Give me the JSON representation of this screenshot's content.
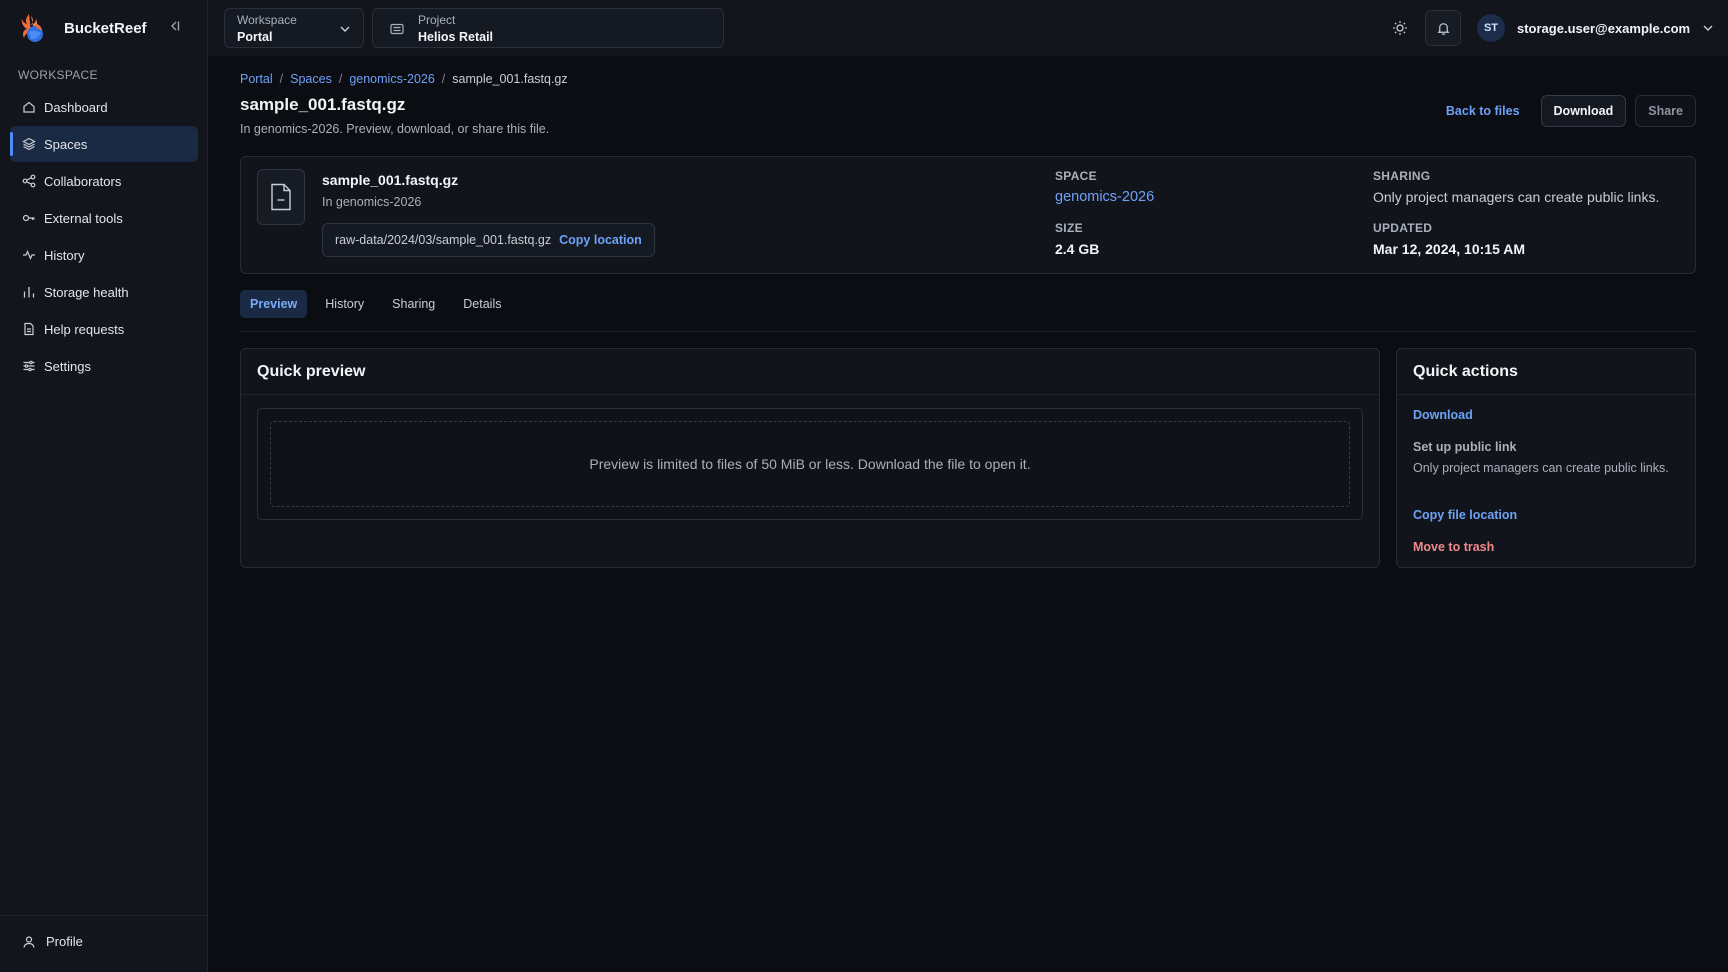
{
  "app": {
    "name": "BucketReef"
  },
  "colors": {
    "accent": "#6ea2f7",
    "danger": "#f08a8a",
    "background": "#0b0d12",
    "surface": "#12151c"
  },
  "sidebar": {
    "section_label": "WORKSPACE",
    "items": [
      {
        "label": "Dashboard",
        "icon": "home-icon"
      },
      {
        "label": "Spaces",
        "icon": "layers-icon",
        "active": true
      },
      {
        "label": "Collaborators",
        "icon": "share-nodes-icon"
      },
      {
        "label": "External tools",
        "icon": "key-icon"
      },
      {
        "label": "History",
        "icon": "activity-icon"
      },
      {
        "label": "Storage health",
        "icon": "bar-chart-icon"
      },
      {
        "label": "Help requests",
        "icon": "document-icon"
      },
      {
        "label": "Settings",
        "icon": "sliders-icon"
      }
    ],
    "profile_label": "Profile"
  },
  "topbar": {
    "workspace": {
      "label": "Workspace",
      "value": "Portal"
    },
    "project": {
      "label": "Project",
      "value": "Helios Retail"
    },
    "user": {
      "initials": "ST",
      "email": "storage.user@example.com"
    }
  },
  "breadcrumb": {
    "items": [
      "Portal",
      "Spaces",
      "genomics-2026"
    ],
    "current": "sample_001.fastq.gz",
    "separator": "/"
  },
  "page": {
    "title": "sample_001.fastq.gz",
    "subtitle": "In genomics-2026. Preview, download, or share this file.",
    "actions": {
      "back": "Back to files",
      "download": "Download",
      "share": "Share"
    }
  },
  "file": {
    "name": "sample_001.fastq.gz",
    "in_label": "In genomics-2026",
    "location": "raw-data/2024/03/sample_001.fastq.gz",
    "copy_location": "Copy location",
    "meta": {
      "space_label": "SPACE",
      "space_value": "genomics-2026",
      "size_label": "SIZE",
      "size_value": "2.4 GB",
      "sharing_label": "SHARING",
      "sharing_value": "Only project managers can create public links.",
      "updated_label": "UPDATED",
      "updated_value": "Mar 12, 2024, 10:15 AM"
    }
  },
  "tabs": [
    {
      "label": "Preview",
      "active": true
    },
    {
      "label": "History"
    },
    {
      "label": "Sharing"
    },
    {
      "label": "Details"
    }
  ],
  "preview": {
    "title": "Quick preview",
    "message": "Preview is limited to files of 50 MiB or less. Download the file to open it."
  },
  "quick_actions": {
    "title": "Quick actions",
    "download": "Download",
    "public_link_title": "Set up public link",
    "public_link_desc": "Only project managers can create public links.",
    "copy_location": "Copy file location",
    "trash": "Move to trash"
  }
}
